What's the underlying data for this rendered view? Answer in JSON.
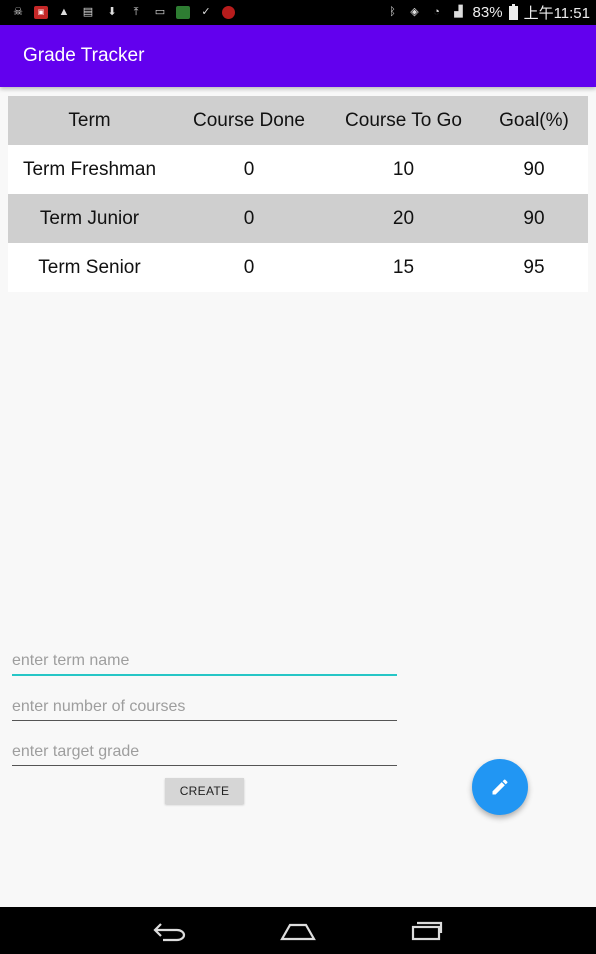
{
  "status_bar": {
    "battery": "83%",
    "time": "上午11:51",
    "icons": [
      "usb-debug-icon",
      "notification-icon",
      "warning-icon",
      "message-icon",
      "wifi-download-icon",
      "upload-icon",
      "image-icon",
      "app-icon",
      "download-done-icon",
      "app-red-icon"
    ]
  },
  "app_bar": {
    "title": "Grade Tracker",
    "color": "#6200ee"
  },
  "table": {
    "headers": [
      "Term",
      "Course Done",
      "Course To Go",
      "Goal(%)"
    ],
    "rows": [
      [
        "Term Freshman",
        "0",
        "10",
        "90"
      ],
      [
        "Term Junior",
        "0",
        "20",
        "90"
      ],
      [
        "Term Senior",
        "0",
        "15",
        "95"
      ]
    ]
  },
  "form": {
    "term_name_placeholder": "enter term name",
    "courses_placeholder": "enter number of courses",
    "grade_placeholder": "enter target grade",
    "create_label": "CREATE"
  },
  "fab": {
    "icon": "pencil-icon",
    "color": "#2196f3"
  },
  "nav": {
    "icons": [
      "back-icon",
      "home-icon",
      "recents-icon"
    ]
  }
}
